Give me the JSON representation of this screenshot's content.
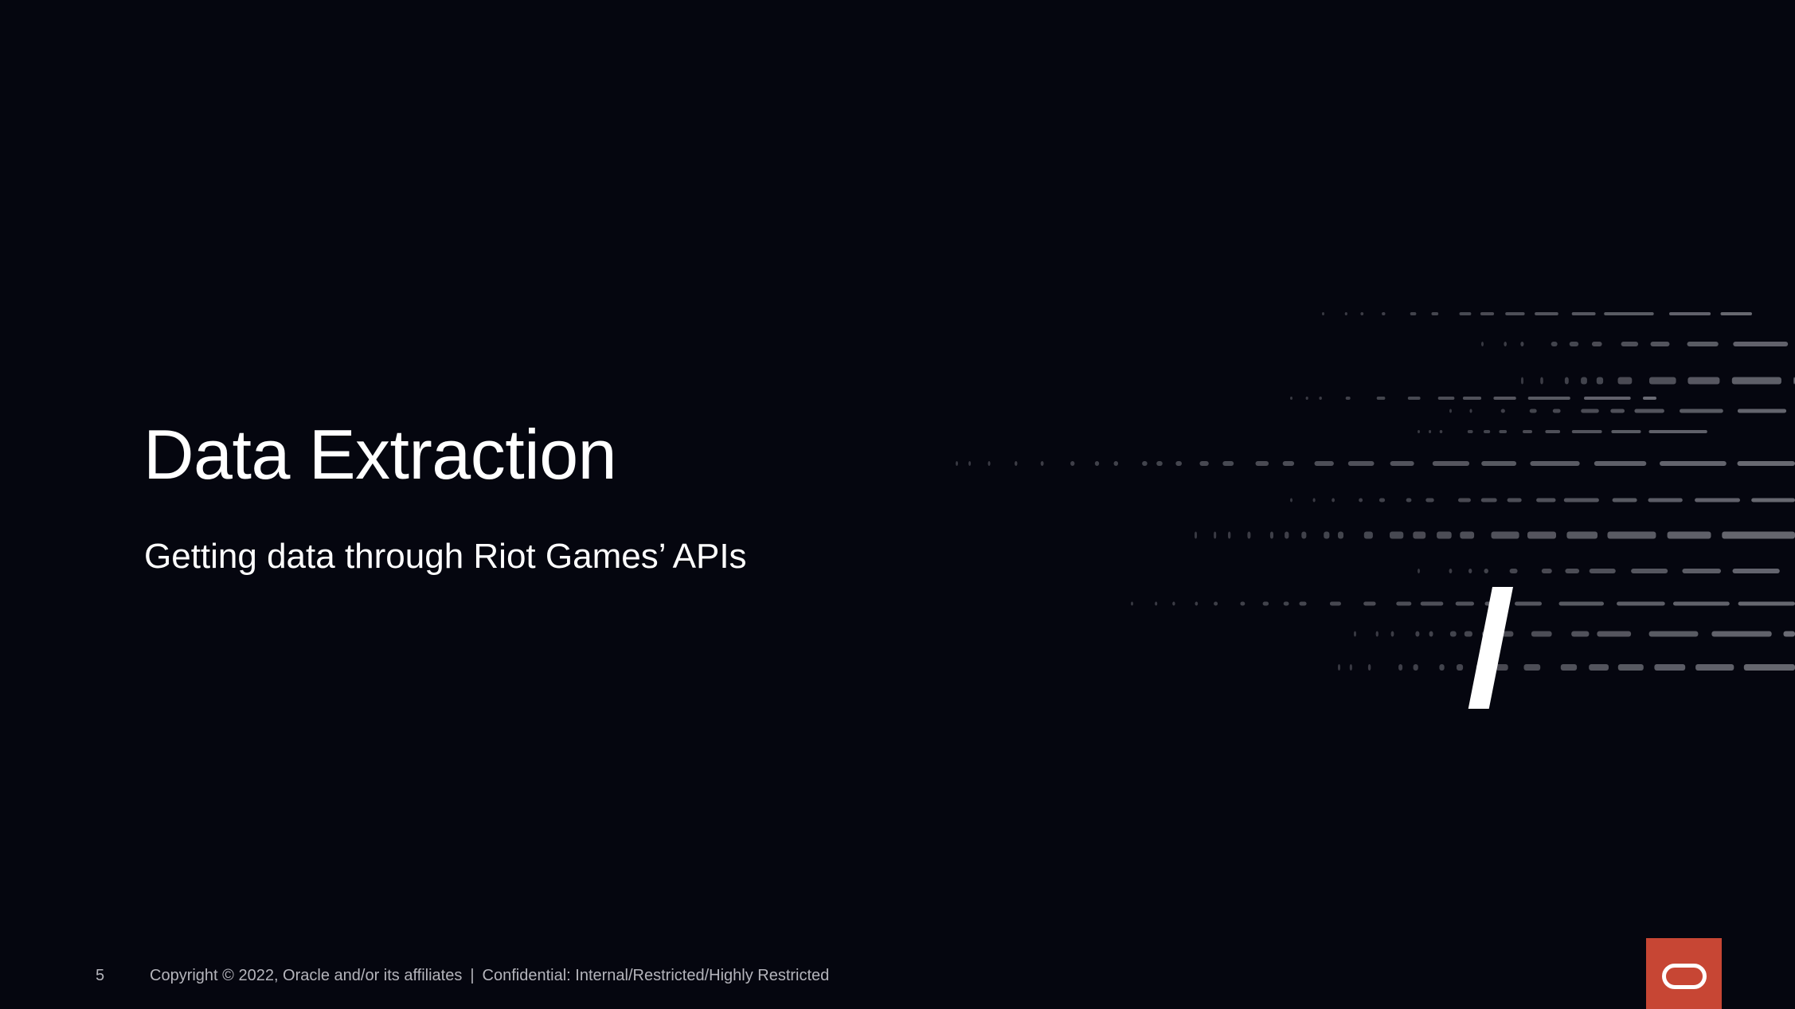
{
  "slide": {
    "title": "Data Extraction",
    "subtitle": "Getting data through Riot Games’ APIs"
  },
  "footer": {
    "page_number": "5",
    "copyright": "Copyright © 2022, Oracle and/or its affiliates",
    "separator": "|",
    "classification": "Confidential: Internal/Restricted/Highly Restricted"
  },
  "colors": {
    "background": "#05060f",
    "accent_green": "#c3e84a",
    "oracle_red": "#c74634",
    "dash_gray": "#6b6c75"
  },
  "icons": {
    "logo": "oracle-logo-icon",
    "decoration": "slash-dash-decoration"
  }
}
